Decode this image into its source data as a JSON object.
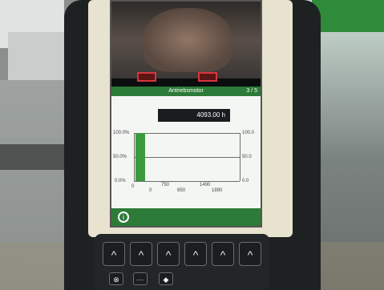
{
  "header": {
    "title": "Antriebsmotor",
    "page_indicator": "3 / 5"
  },
  "readout": {
    "hours": "4093.00 h"
  },
  "chart_data": {
    "type": "bar",
    "x_tick_labels": [
      "0",
      "750",
      "850",
      "1490",
      "1890"
    ],
    "y_tick_labels": [
      "100.0%",
      "50.0%",
      "0.0%"
    ],
    "right_tick_labels": [
      "100.0",
      "50.0",
      "0.0"
    ],
    "values": [
      100
    ],
    "colors": {
      "bar": "#3c9b3c"
    }
  },
  "keys": {
    "soft_keys": [
      "^",
      "^",
      "^",
      "^",
      "^",
      "^"
    ],
    "lower_keys": [
      "⊗",
      "⋯",
      "◆"
    ]
  },
  "colors": {
    "header_green": "#2d7b38",
    "red_buttons": "#d9363e"
  }
}
